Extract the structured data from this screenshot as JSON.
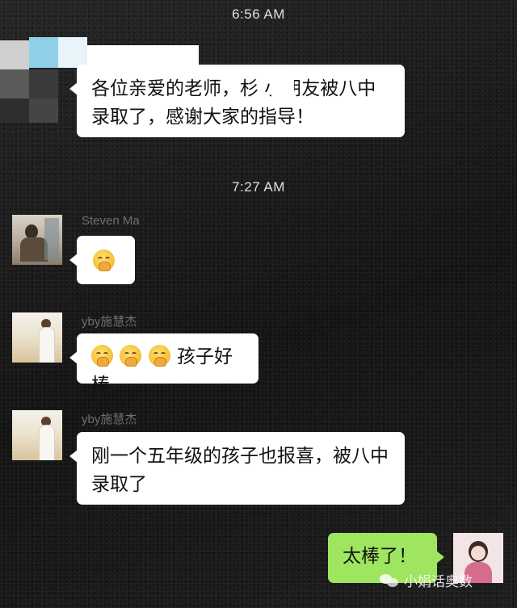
{
  "messages": {
    "time1": "6:56 AM",
    "msg1_text": "各位亲爱的老师，杉 小朋友被八中录取了，感谢大家的指导！",
    "time2": "7:27 AM",
    "sender_steven": "Steven Ma",
    "sender_yby1": "yby施慧杰",
    "msg3_text": "孩子好棒",
    "sender_yby2": "yby施慧杰",
    "msg4_text": "刚一个五年级的孩子也报喜，被八中录取了",
    "msg5_text": "太棒了！"
  },
  "watermark": {
    "text": "小娟话奥数",
    "icon": "wechat-icon"
  },
  "colors": {
    "background": "#1b1b1b",
    "incoming_bubble": "#ffffff",
    "outgoing_bubble": "#9fe55f",
    "timestamp": "#e0e0e0",
    "sender_name": "#6f6f6f"
  },
  "icons": [
    "pixelated-avatar",
    "avatar-steven-ma",
    "avatar-yby",
    "avatar-self",
    "hugging-emoji",
    "wechat-icon"
  ]
}
